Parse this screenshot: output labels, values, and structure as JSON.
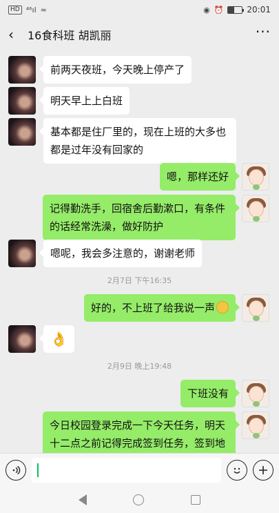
{
  "status_bar": {
    "left_badge": "HD",
    "signal": "⁴⁶ıl",
    "wifi": "≈",
    "time": "20:01"
  },
  "header": {
    "back_icon": "chevron-left",
    "title": "16食科班 胡凯丽",
    "more_label": "···"
  },
  "messages": [
    {
      "side": "left",
      "text": "前两天夜班，今天晚上停产了"
    },
    {
      "side": "left",
      "text": "明天早上上白班"
    },
    {
      "side": "left",
      "text": "基本都是住厂里的，现在上班的大多也都是过年没有回家的"
    },
    {
      "side": "right",
      "text": "嗯，那样还好"
    },
    {
      "side": "right",
      "text": "记得勤洗手，回宿舍后勤漱口，有条件的话经常洗澡，做好防护"
    },
    {
      "side": "left",
      "text": "嗯呢，我会多注意的，谢谢老师"
    },
    {
      "timestamp": "2月7日 下午16:35"
    },
    {
      "side": "right",
      "text": "好的，不上班了给我说一声"
    },
    {
      "side": "left",
      "text": "👌"
    },
    {
      "timestamp": "2月9日 晚上19:48"
    },
    {
      "side": "right",
      "text": "下班没有"
    },
    {
      "side": "right",
      "text": "今日校园登录完成一下今天任务，明天十二点之前记得完成签到任务，签到地点是你目前所在位置"
    }
  ],
  "input": {
    "voice_icon": "voice-icon",
    "emoji_icon": "emoji-icon",
    "add_icon": "plus-icon",
    "value": ""
  },
  "colors": {
    "bubble_self": "#95ec69",
    "bubble_other": "#ffffff",
    "background": "#ededed"
  }
}
